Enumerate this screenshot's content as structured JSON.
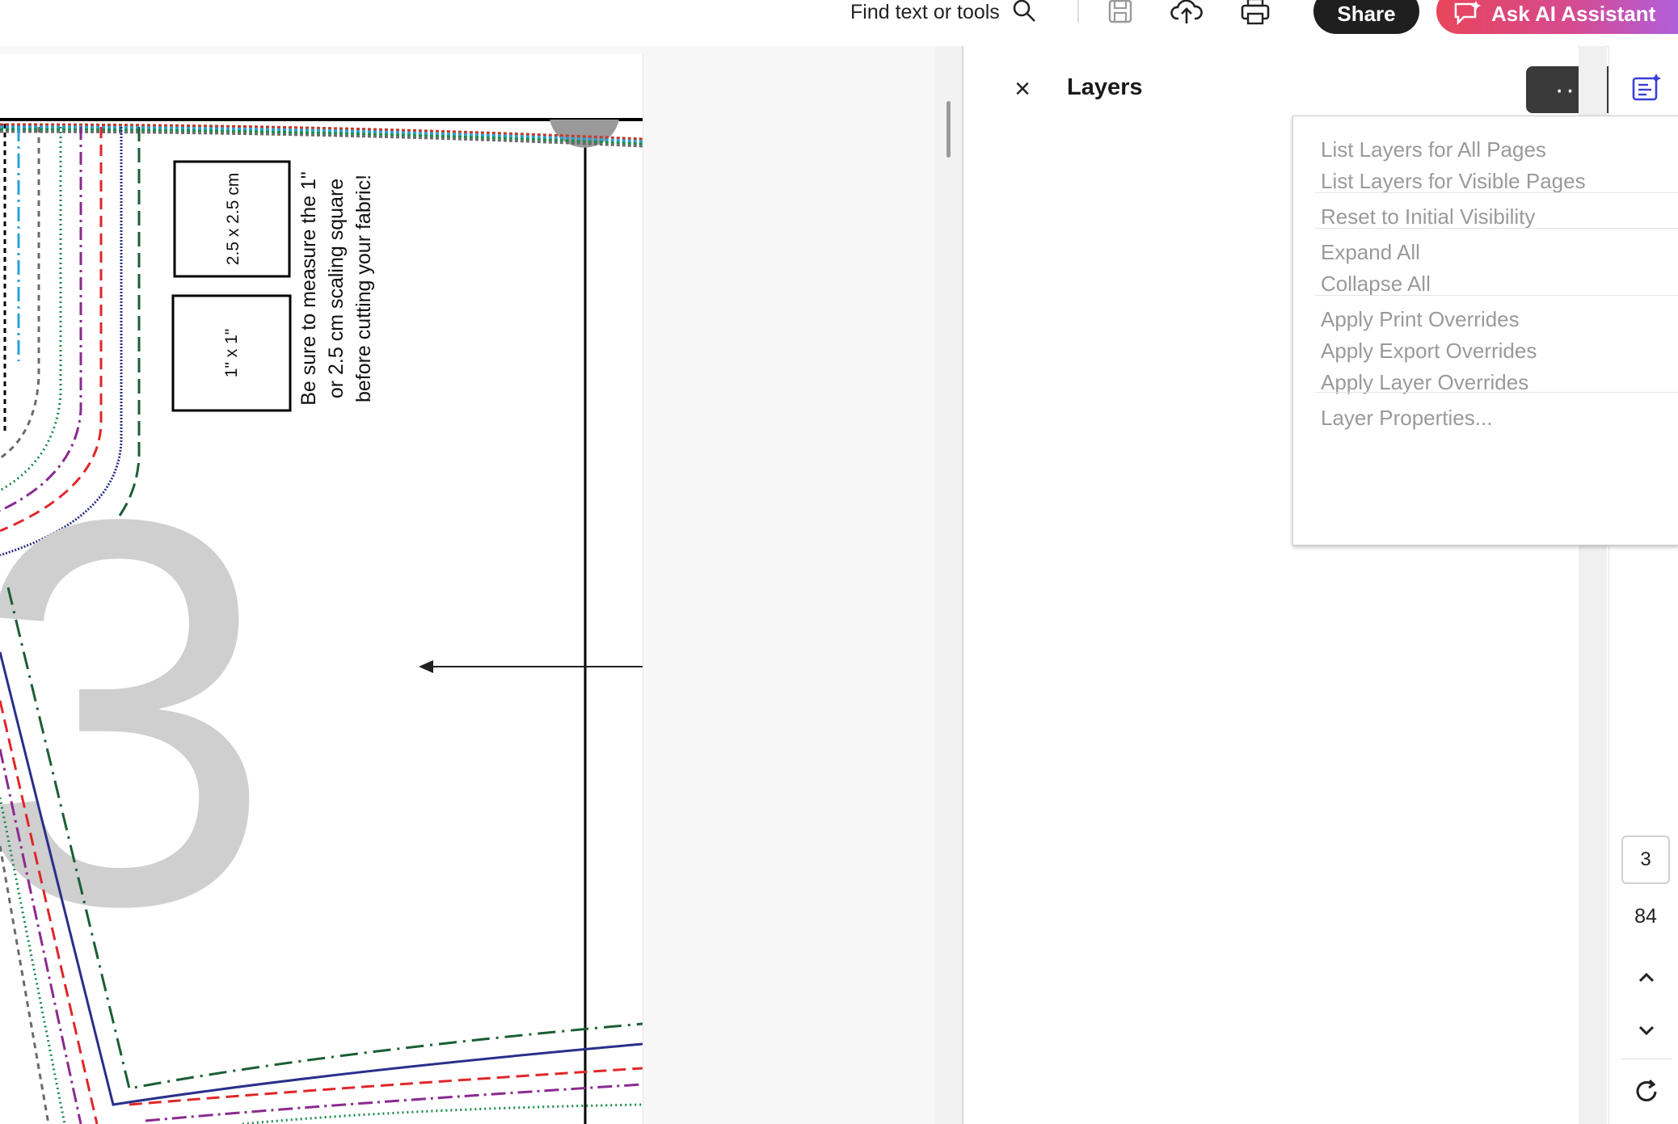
{
  "toolbar": {
    "find_label": "Find text or tools",
    "share_label": "Share",
    "ai_label": "Ask AI Assistant",
    "icons": [
      "search-icon",
      "save-icon",
      "upload-icon",
      "print-icon",
      "ai-chat-icon"
    ]
  },
  "document": {
    "scale_box_metric": "2.5 x 2.5 cm",
    "scale_box_imperial": "1\" x 1\"",
    "instruction_lines": [
      "Be sure to measure the 1\"",
      "or 2.5 cm scaling square",
      "before cutting your fabric!"
    ],
    "big_number": "3",
    "line_colors": [
      "#1b5e34",
      "#2a2f8a",
      "#e0262a",
      "#8a2a8f",
      "#1a8a4a",
      "#6b6b6b",
      "#2aa0d8"
    ]
  },
  "layers_panel": {
    "title": "Layers",
    "close_icon": "close-icon",
    "more_label": "···"
  },
  "menu": {
    "groups": [
      [
        "List Layers for All Pages",
        "List Layers for Visible Pages"
      ],
      [
        "Reset to Initial Visibility"
      ],
      [
        "Expand All",
        "Collapse All"
      ],
      [
        "Apply Print Overrides",
        "Apply Export Overrides",
        "Apply Layer Overrides"
      ],
      [
        "Layer Properties..."
      ]
    ]
  },
  "page_nav": {
    "current_page": "3",
    "total_pages": "84",
    "icons": [
      "chevron-up-icon",
      "chevron-down-icon",
      "refresh-icon",
      "edit-panel-icon"
    ]
  }
}
